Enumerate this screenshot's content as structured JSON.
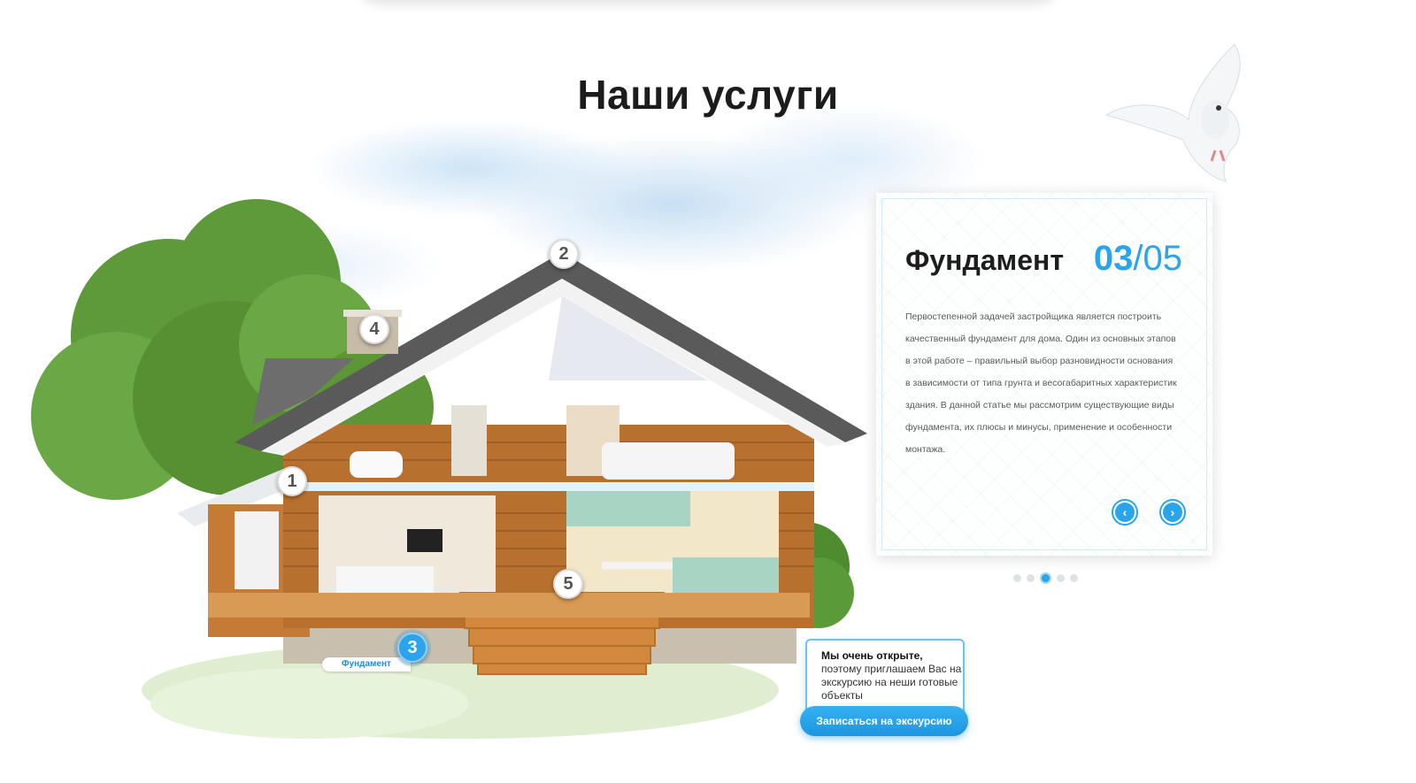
{
  "section": {
    "title": "Наши услуги"
  },
  "hotspots": [
    {
      "number": "1"
    },
    {
      "number": "2"
    },
    {
      "number": "3",
      "active": true,
      "label": "Фундамент"
    },
    {
      "number": "4"
    },
    {
      "number": "5"
    }
  ],
  "card": {
    "title": "Фундамент",
    "counter_current": "03",
    "counter_separator": "/",
    "counter_total": "05",
    "text": "Первостепенной задачей застройщика является построить качественный фундамент для дома. Один из основных этапов в этой работе – правильный выбор разновидности основания в зависимости от типа грунта и весогабаритных характеристик здания. В данной статье мы рассмотрим существующие виды фундамента, их плюсы и минусы, применение и особенности монтажа.",
    "prev_icon": "chevron-left-icon",
    "next_icon": "chevron-right-icon",
    "prev_glyph": "‹",
    "next_glyph": "›"
  },
  "pagination": {
    "count": 5,
    "active_index": 2
  },
  "tour": {
    "bold": "Мы очень открыте,",
    "text": "поэтому приглашаем Вас на экскурсию на неши готовые объекты",
    "button_label": "Записаться на экскурсию"
  },
  "colors": {
    "accent": "#2aa4ea",
    "title": "#1c1c1c"
  }
}
